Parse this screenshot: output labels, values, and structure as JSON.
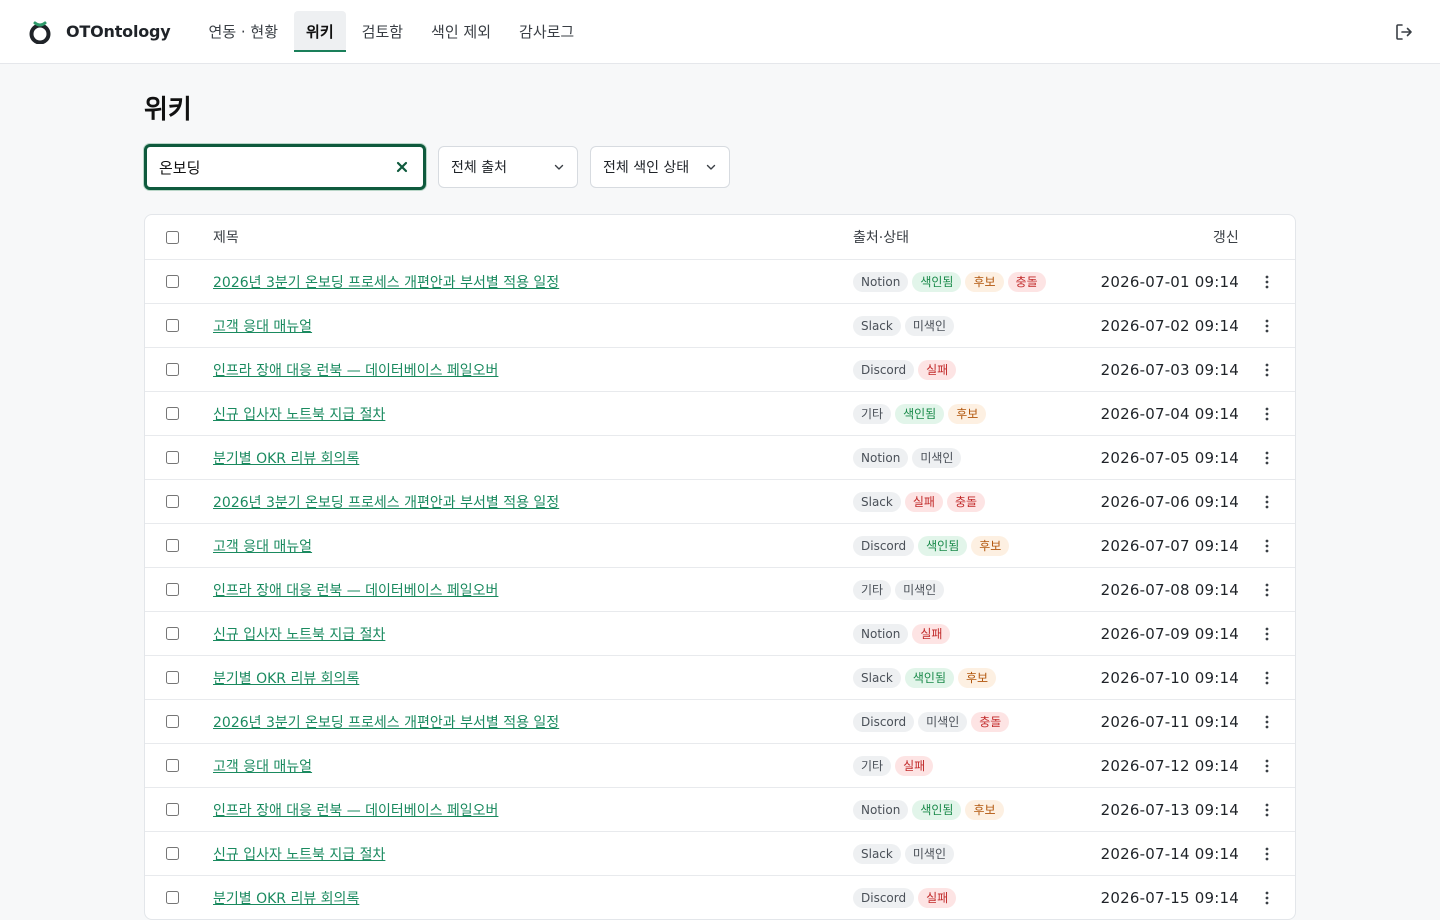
{
  "app": {
    "name": "OTOntology"
  },
  "nav": [
    {
      "label": "연동 · 현황",
      "active": false
    },
    {
      "label": "위키",
      "active": true
    },
    {
      "label": "검토함",
      "active": false
    },
    {
      "label": "색인 제외",
      "active": false
    },
    {
      "label": "감사로그",
      "active": false
    }
  ],
  "page": {
    "title": "위키"
  },
  "search": {
    "value": "온보딩"
  },
  "filters": {
    "source": "전체 출처",
    "index_status": "전체 색인 상태"
  },
  "table": {
    "headers": {
      "title": "제목",
      "source_status": "출처·상태",
      "updated": "갱신"
    },
    "rows": [
      {
        "title": "2026년 3분기 온보딩 프로세스 개편안과 부서별 적용 일정",
        "source": "Notion",
        "tags": [
          {
            "label": "색인됨",
            "kind": "indexed"
          },
          {
            "label": "후보",
            "kind": "candidate"
          },
          {
            "label": "충돌",
            "kind": "conflict"
          }
        ],
        "updated": "2026-07-01 09:14"
      },
      {
        "title": "고객 응대 매뉴얼",
        "source": "Slack",
        "tags": [
          {
            "label": "미색인",
            "kind": "unindexed"
          }
        ],
        "updated": "2026-07-02 09:14"
      },
      {
        "title": "인프라 장애 대응 런북 — 데이터베이스 페일오버",
        "source": "Discord",
        "tags": [
          {
            "label": "실패",
            "kind": "failed"
          }
        ],
        "updated": "2026-07-03 09:14"
      },
      {
        "title": "신규 입사자 노트북 지급 절차",
        "source": "기타",
        "tags": [
          {
            "label": "색인됨",
            "kind": "indexed"
          },
          {
            "label": "후보",
            "kind": "candidate"
          }
        ],
        "updated": "2026-07-04 09:14"
      },
      {
        "title": "분기별 OKR 리뷰 회의록",
        "source": "Notion",
        "tags": [
          {
            "label": "미색인",
            "kind": "unindexed"
          }
        ],
        "updated": "2026-07-05 09:14"
      },
      {
        "title": "2026년 3분기 온보딩 프로세스 개편안과 부서별 적용 일정",
        "source": "Slack",
        "tags": [
          {
            "label": "실패",
            "kind": "failed"
          },
          {
            "label": "충돌",
            "kind": "conflict"
          }
        ],
        "updated": "2026-07-06 09:14"
      },
      {
        "title": "고객 응대 매뉴얼",
        "source": "Discord",
        "tags": [
          {
            "label": "색인됨",
            "kind": "indexed"
          },
          {
            "label": "후보",
            "kind": "candidate"
          }
        ],
        "updated": "2026-07-07 09:14"
      },
      {
        "title": "인프라 장애 대응 런북 — 데이터베이스 페일오버",
        "source": "기타",
        "tags": [
          {
            "label": "미색인",
            "kind": "unindexed"
          }
        ],
        "updated": "2026-07-08 09:14"
      },
      {
        "title": "신규 입사자 노트북 지급 절차",
        "source": "Notion",
        "tags": [
          {
            "label": "실패",
            "kind": "failed"
          }
        ],
        "updated": "2026-07-09 09:14"
      },
      {
        "title": "분기별 OKR 리뷰 회의록",
        "source": "Slack",
        "tags": [
          {
            "label": "색인됨",
            "kind": "indexed"
          },
          {
            "label": "후보",
            "kind": "candidate"
          }
        ],
        "updated": "2026-07-10 09:14"
      },
      {
        "title": "2026년 3분기 온보딩 프로세스 개편안과 부서별 적용 일정",
        "source": "Discord",
        "tags": [
          {
            "label": "미색인",
            "kind": "unindexed"
          },
          {
            "label": "충돌",
            "kind": "conflict"
          }
        ],
        "updated": "2026-07-11 09:14"
      },
      {
        "title": "고객 응대 매뉴얼",
        "source": "기타",
        "tags": [
          {
            "label": "실패",
            "kind": "failed"
          }
        ],
        "updated": "2026-07-12 09:14"
      },
      {
        "title": "인프라 장애 대응 런북 — 데이터베이스 페일오버",
        "source": "Notion",
        "tags": [
          {
            "label": "색인됨",
            "kind": "indexed"
          },
          {
            "label": "후보",
            "kind": "candidate"
          }
        ],
        "updated": "2026-07-13 09:14"
      },
      {
        "title": "신규 입사자 노트북 지급 절차",
        "source": "Slack",
        "tags": [
          {
            "label": "미색인",
            "kind": "unindexed"
          }
        ],
        "updated": "2026-07-14 09:14"
      },
      {
        "title": "분기별 OKR 리뷰 회의록",
        "source": "Discord",
        "tags": [
          {
            "label": "실패",
            "kind": "failed"
          }
        ],
        "updated": "2026-07-15 09:14"
      }
    ]
  }
}
